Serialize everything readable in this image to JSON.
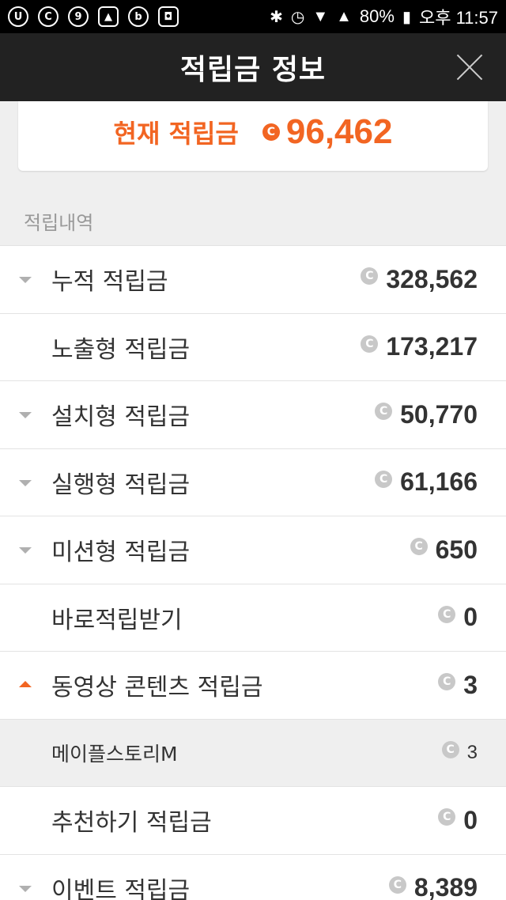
{
  "status_bar": {
    "battery": "80%",
    "time": "오후 11:57",
    "left_icons": [
      "u-plus-icon",
      "c-icon",
      "nine-icon",
      "image-icon",
      "b-icon",
      "lock-icon"
    ],
    "right_icons": [
      "bluetooth-icon",
      "alarm-icon",
      "wifi-icon",
      "signal-icon",
      "battery-icon"
    ]
  },
  "header": {
    "title": "적립금 정보"
  },
  "current": {
    "label": "현재 적립금",
    "coin_glyph": "C",
    "value": "96,462"
  },
  "section": {
    "title": "적립내역"
  },
  "rows": [
    {
      "label": "누적 적립금",
      "value": "328,562",
      "arrow": "down",
      "sub": false
    },
    {
      "label": "노출형 적립금",
      "value": "173,217",
      "arrow": "none",
      "sub": false
    },
    {
      "label": "설치형 적립금",
      "value": "50,770",
      "arrow": "down",
      "sub": false
    },
    {
      "label": "실행형 적립금",
      "value": "61,166",
      "arrow": "down",
      "sub": false
    },
    {
      "label": "미션형 적립금",
      "value": "650",
      "arrow": "down",
      "sub": false
    },
    {
      "label": "바로적립받기",
      "value": "0",
      "arrow": "none",
      "sub": false
    },
    {
      "label": "동영상 콘텐츠 적립금",
      "value": "3",
      "arrow": "up",
      "sub": false
    },
    {
      "label": "메이플스토리M",
      "value": "3",
      "arrow": "none",
      "sub": true
    },
    {
      "label": "추천하기 적립금",
      "value": "0",
      "arrow": "none",
      "sub": false
    },
    {
      "label": "이벤트 적립금",
      "value": "8,389",
      "arrow": "down",
      "sub": false
    }
  ],
  "colors": {
    "accent": "#f26522",
    "app_bar": "#222222",
    "background": "#efefef"
  }
}
